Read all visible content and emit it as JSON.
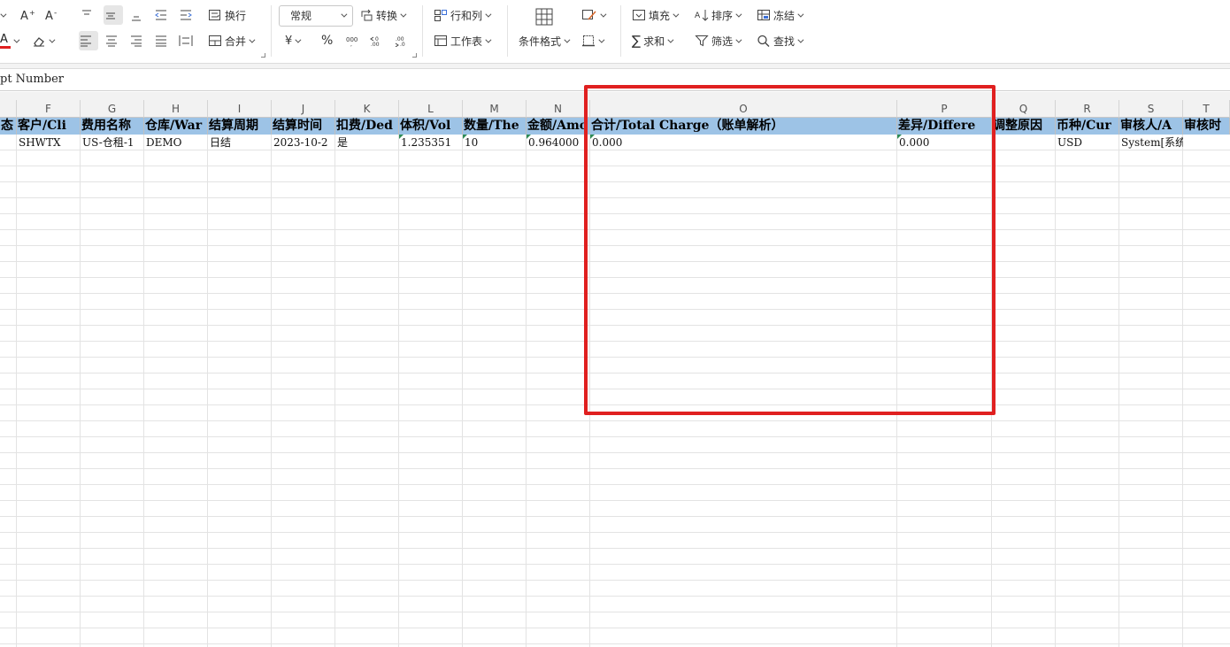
{
  "ribbon": {
    "font_color_label": "A",
    "font_color_accent": "#e02020",
    "wrap_label": "换行",
    "merge_label": "合并",
    "number_format": "常规",
    "convert_label": "转换",
    "currency_symbol": "¥",
    "percent_symbol": "%",
    "rowcol_label": "行和列",
    "worksheet_label": "工作表",
    "conditional_format_label": "条件格式",
    "fill_label": "填充",
    "sort_label": "排序",
    "freeze_label": "冻结",
    "sum_label": "求和",
    "filter_label": "筛选",
    "find_label": "查找"
  },
  "formula_bar": {
    "content": "pt Number"
  },
  "columns": [
    "F",
    "G",
    "H",
    "I",
    "J",
    "K",
    "L",
    "M",
    "N",
    "O",
    "P",
    "Q",
    "R",
    "S",
    "T"
  ],
  "header_row": [
    "态",
    "客户/Cli",
    "费用名称",
    "仓库/War",
    "结算周期",
    "结算时间",
    "扣费/Ded",
    "体积/Vol",
    "数量/The",
    "金额/Amo",
    "合计/Total Charge（账单解析）",
    "差异/Differe",
    "调整原因",
    "币种/Cur",
    "审核人/A",
    "审核时"
  ],
  "data_row": [
    "",
    "SHWTX",
    "US-仓租-1",
    "DEMO",
    "日结",
    "2023-10-2",
    "是",
    "1.235351",
    "10",
    "0.964000",
    "0.000",
    "0.000",
    "",
    "USD",
    "System[系统]",
    ""
  ],
  "accent_colors": {
    "header_fill": "#9dc3e6",
    "highlight_box": "#e02020"
  }
}
